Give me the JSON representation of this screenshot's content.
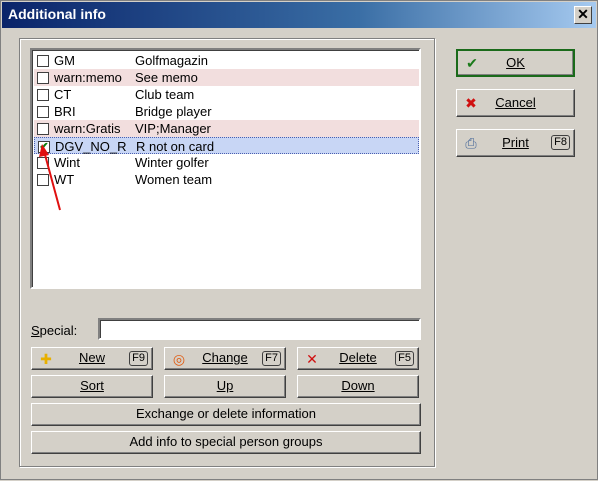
{
  "window": {
    "title": "Additional info",
    "close_symbol": "✕"
  },
  "list": {
    "rows": [
      {
        "checked": false,
        "code": "GM",
        "description": "Golfmagazin",
        "highlight": "none"
      },
      {
        "checked": false,
        "code": "warn:memo",
        "description": "See memo",
        "highlight": "warn"
      },
      {
        "checked": false,
        "code": "CT",
        "description": "Club team",
        "highlight": "none"
      },
      {
        "checked": false,
        "code": "BRI",
        "description": "Bridge player",
        "highlight": "none"
      },
      {
        "checked": false,
        "code": "warn:Gratis",
        "description": "VIP;Manager",
        "highlight": "warn"
      },
      {
        "checked": true,
        "code": "DGV_NO_R",
        "description": "R not on card",
        "highlight": "selected"
      },
      {
        "checked": false,
        "code": "Wint",
        "description": "Winter golfer",
        "highlight": "none"
      },
      {
        "checked": false,
        "code": "WT",
        "description": "Women team",
        "highlight": "none"
      }
    ]
  },
  "special": {
    "label": "Special:",
    "value": ""
  },
  "buttons": {
    "new": {
      "label": "New",
      "key": "F9"
    },
    "change": {
      "label": "Change",
      "key": "F7"
    },
    "delete": {
      "label": "Delete",
      "key": "F5"
    },
    "sort": {
      "label": "Sort"
    },
    "up": {
      "label": "Up"
    },
    "down": {
      "label": "Down"
    },
    "exchange": {
      "label": "Exchange or delete information"
    },
    "add_info": {
      "label": "Add info to special person groups"
    },
    "ok": {
      "label": "OK"
    },
    "cancel": {
      "label": "Cancel"
    },
    "print": {
      "label": "Print",
      "key": "F8"
    }
  },
  "colors": {
    "warn_row": "#f2dede",
    "selected_row": "#c8d6f5",
    "title_bar": "#0a246a",
    "annotation_arrow": "#e01010"
  }
}
